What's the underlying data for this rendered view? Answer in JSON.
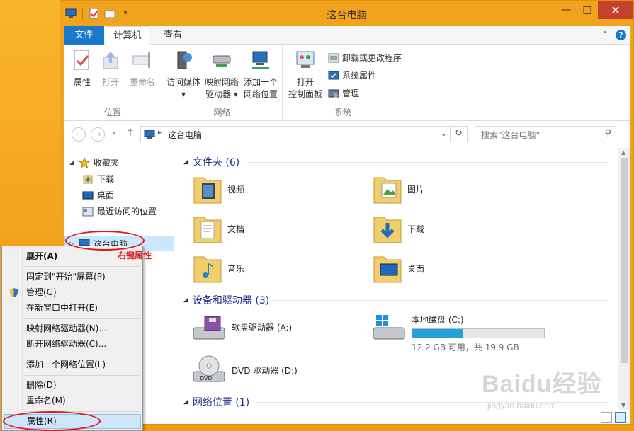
{
  "window": {
    "title": "这台电脑",
    "controls": {
      "minimize": "—",
      "maximize": "□",
      "close": "✕"
    }
  },
  "ribbon_tabs": [
    {
      "label": "文件",
      "active": false
    },
    {
      "label": "计算机",
      "active": true
    },
    {
      "label": "查看",
      "active": false
    }
  ],
  "ribbon": {
    "location_group": {
      "label": "位置",
      "buttons": [
        "属性",
        "打开",
        "重命名"
      ]
    },
    "network_group": {
      "label": "网络",
      "access_media": [
        "访问媒体",
        "▾"
      ],
      "map_drive": [
        "映射网络",
        "驱动器 ▾"
      ],
      "add_location": [
        "添加一个",
        "网络位置"
      ]
    },
    "system_group": {
      "label": "系统",
      "open_cp": [
        "打开",
        "控制面板"
      ],
      "uninstall": "卸载或更改程序",
      "sys_props": "系统属性",
      "manage": "管理"
    }
  },
  "address": {
    "crumb": "这台电脑",
    "search_placeholder": "搜索\"这台电脑\""
  },
  "nav_pane": {
    "favorites": "收藏夹",
    "downloads": "下载",
    "desktop": "桌面",
    "recent": "最近访问的位置",
    "this_pc": "这台电脑"
  },
  "content": {
    "folders_head": "文件夹 (6)",
    "folders": [
      "视频",
      "图片",
      "文档",
      "下载",
      "音乐",
      "桌面"
    ],
    "devices_head": "设备和驱动器 (3)",
    "floppy": "软盘驱动器 (A:)",
    "local_disk": {
      "name": "本地磁盘 (C:)",
      "free": "12.2 GB 可用，共 19.9 GB",
      "used_fraction": 0.387
    },
    "dvd": "DVD 驱动器 (D:)",
    "network_head": "网络位置 (1)"
  },
  "context_menu": {
    "items": [
      "展开(A)",
      "固定到\"开始\"屏幕(P)",
      "管理(G)",
      "在新窗口中打开(E)",
      "映射网络驱动器(N)...",
      "断开网络驱动器(C)...",
      "添加一个网络位置(L)",
      "删除(D)",
      "重命名(M)",
      "属性(R)"
    ]
  },
  "annotation": {
    "text": "右键属性",
    "color": "#e0191b"
  },
  "watermark": {
    "main": "Baidu经验",
    "sub": "jingyan.baidu.com"
  },
  "colors": {
    "accent": "#1979ca",
    "titlebar": "#f2a31d",
    "close": "#c7402c",
    "drive_fill": "#26a0da"
  }
}
